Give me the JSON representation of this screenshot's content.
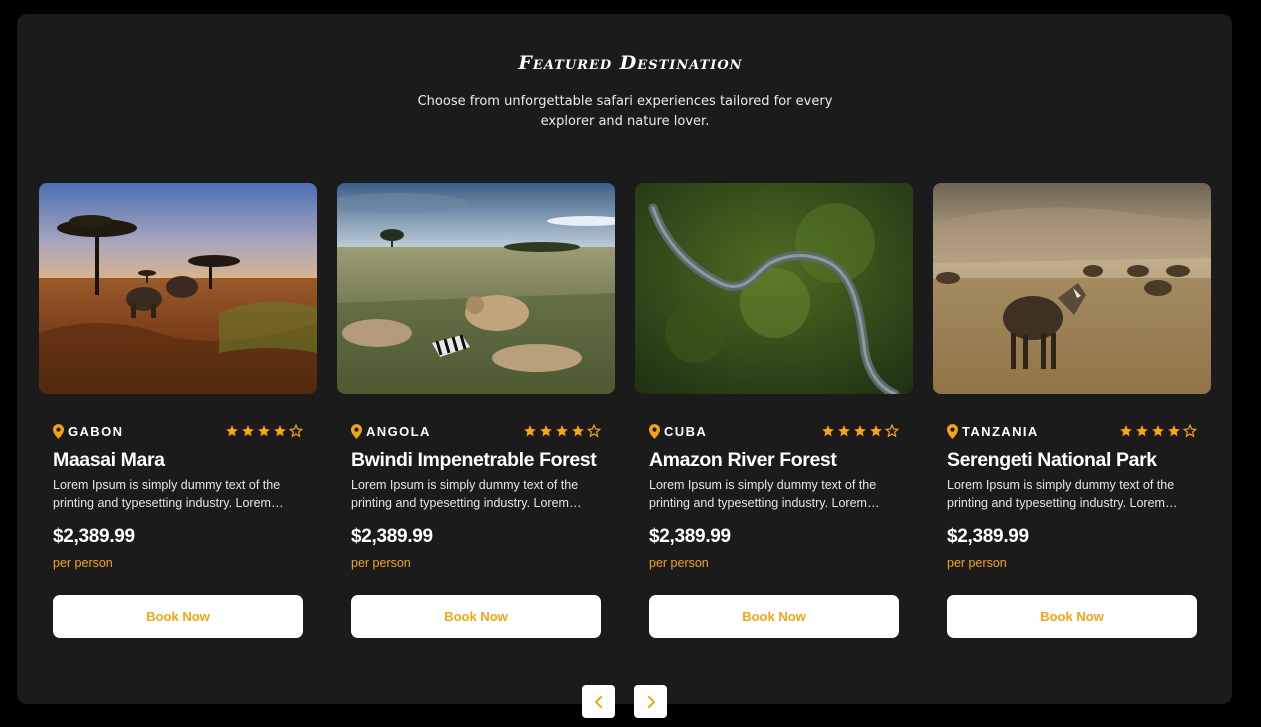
{
  "section": {
    "title": "Featured Destination",
    "subtitle_line1": "Choose from unforgettable safari experiences tailored for every",
    "subtitle_line2": "explorer and nature lover."
  },
  "colors": {
    "accent": "#f5a416",
    "panel": "#1b1b1b",
    "page": "#000000"
  },
  "cards": [
    {
      "image_alt": "Savanna at sunset with acacia trees and elephants",
      "country": "GABON",
      "rating": 4,
      "rating_max": 5,
      "title": "Maasai Mara",
      "description": "Lorem Ipsum is simply dummy text of the printing and typesetting industry. Lorem Ipsum has been the industry's standard dummy text.",
      "price": "$2,389.99",
      "price_unit": "per person",
      "cta": "Book Now"
    },
    {
      "image_alt": "Lions feeding on a zebra in tall grass",
      "country": "ANGOLA",
      "rating": 4,
      "rating_max": 5,
      "title": "Bwindi Impenetrable Forest",
      "description": "Lorem Ipsum is simply dummy text of the printing and typesetting industry. Lorem Ipsum has been the industry's standard dummy text.",
      "price": "$2,389.99",
      "price_unit": "per person",
      "cta": "Book Now"
    },
    {
      "image_alt": "Aerial view of a river winding through forest",
      "country": "CUBA",
      "rating": 4,
      "rating_max": 5,
      "title": "Amazon River Forest",
      "description": "Lorem Ipsum is simply dummy text of the printing and typesetting industry. Lorem Ipsum has been the industry's standard dummy text.",
      "price": "$2,389.99",
      "price_unit": "per person",
      "cta": "Book Now"
    },
    {
      "image_alt": "Wildebeest on the plains",
      "country": "TANZANIA",
      "rating": 4,
      "rating_max": 5,
      "title": "Serengeti National Park",
      "description": "Lorem Ipsum is simply dummy text of the printing and typesetting industry. Lorem Ipsum has been the industry's standard dummy text.",
      "price": "$2,389.99",
      "price_unit": "per person",
      "cta": "Book Now"
    }
  ],
  "carousel": {
    "prev_icon": "chevron-left-icon",
    "next_icon": "chevron-right-icon"
  }
}
